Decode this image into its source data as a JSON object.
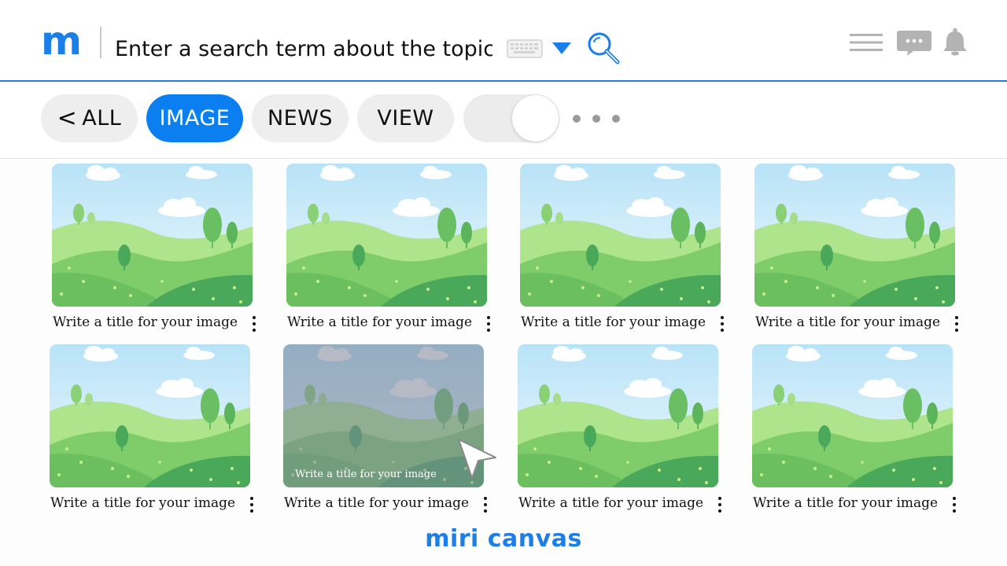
{
  "header": {
    "logo": "m",
    "search_placeholder": "Enter a search term about the topic."
  },
  "icons": {
    "keyboard": "keyboard-icon",
    "dropdown": "chevron-down-icon",
    "search": "search-icon",
    "menu": "hamburger-menu-icon",
    "chat": "chat-bubble-icon",
    "notifications": "bell-icon",
    "pointer": "mouse-pointer-icon"
  },
  "tabs": [
    {
      "label": "ALL",
      "prefix": "<",
      "active": false
    },
    {
      "label": "IMAGE",
      "active": true
    },
    {
      "label": "NEWS",
      "active": false
    },
    {
      "label": "VIEW",
      "active": false
    }
  ],
  "toggle": {
    "on": true
  },
  "results": [
    {
      "title": "Write a title for your image"
    },
    {
      "title": "Write a title for your image"
    },
    {
      "title": "Write a title for your image"
    },
    {
      "title": "Write a title for your image"
    },
    {
      "title": "Write a title for your image"
    },
    {
      "title": "Write a title for your image",
      "hovered": true,
      "overlay_title": "Write a title for your image"
    },
    {
      "title": "Write a title for your image"
    },
    {
      "title": "Write a title for your image"
    }
  ],
  "footer": {
    "brand": "miri canvas"
  },
  "colors": {
    "accent": "#0b7ff0",
    "tab_bg": "#eeeeee",
    "brand": "#1a7fe8"
  }
}
